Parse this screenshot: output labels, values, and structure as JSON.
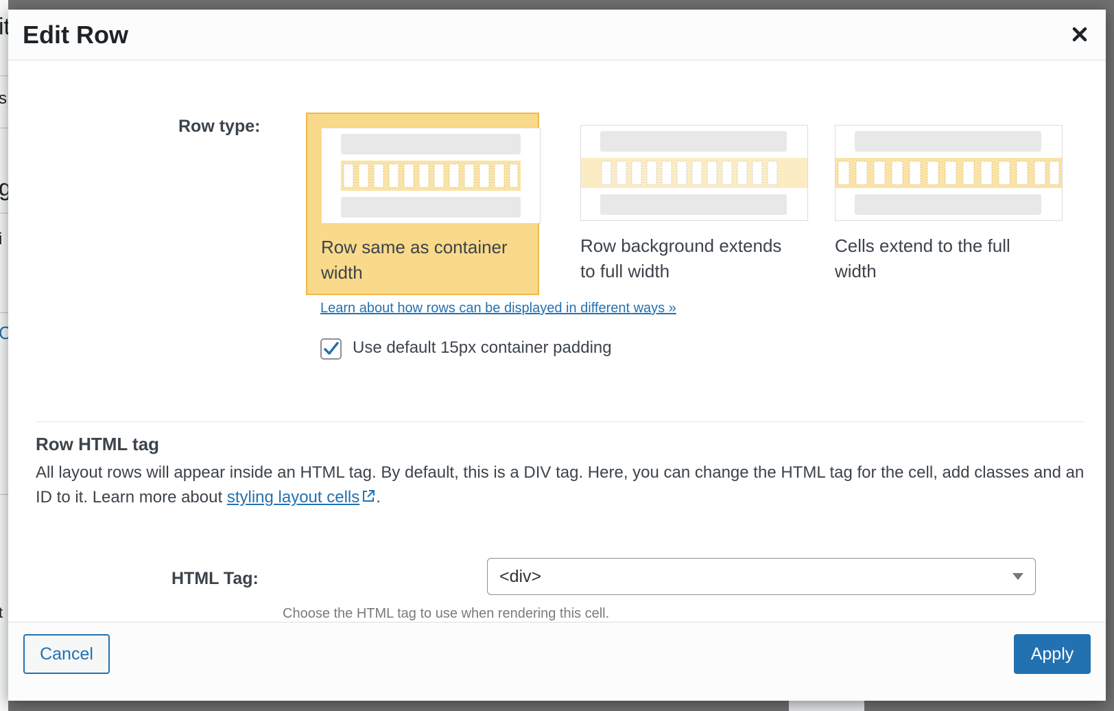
{
  "background": {
    "left_fragments": [
      "it",
      "s",
      "g",
      "i",
      "C",
      "t"
    ]
  },
  "modal": {
    "title": "Edit Row",
    "close_icon": "close-icon"
  },
  "row_type": {
    "label": "Row type:",
    "options": [
      {
        "caption": "Row same as container width",
        "selected": true
      },
      {
        "caption": "Row background extends to full width",
        "selected": false
      },
      {
        "caption": "Cells extend to the full width",
        "selected": false
      }
    ],
    "learn_link": "Learn about how rows can be displayed in different ways »",
    "padding_checkbox": {
      "label": "Use default 15px container padding",
      "checked": true
    }
  },
  "html_tag_section": {
    "title": "Row HTML tag",
    "desc_before": "All layout rows will appear inside an HTML tag. By default, this is a DIV tag. Here, you can change the HTML tag for the cell, add classes and an ID to it. Learn more about ",
    "desc_link": "styling layout cells",
    "desc_after": ".",
    "tag_label": "HTML Tag:",
    "tag_value": "<div>",
    "help_text": "Choose the HTML tag to use when rendering this cell."
  },
  "footer": {
    "cancel_label": "Cancel",
    "apply_label": "Apply"
  },
  "colors": {
    "accent": "#2271b1",
    "selected_bg": "#f9d98a",
    "selected_border": "#f0b849"
  }
}
